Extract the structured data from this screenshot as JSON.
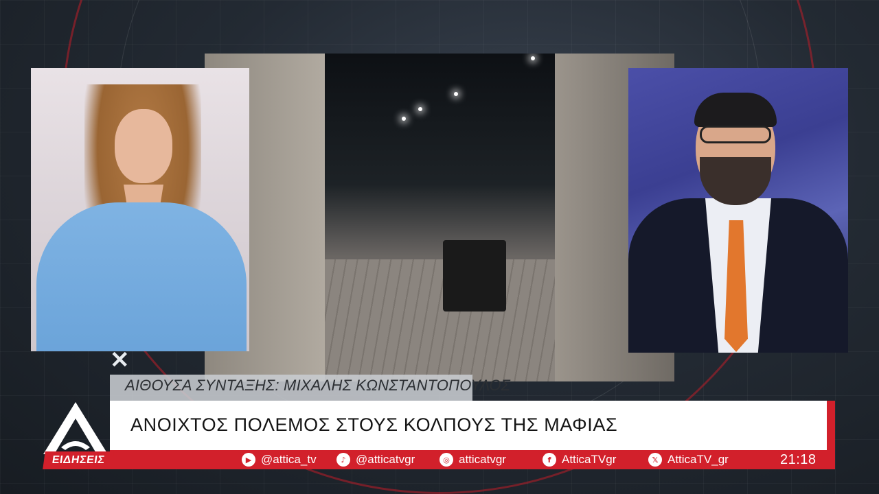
{
  "reporter": {
    "text": "ΑΙΘΟΥΣΑ ΣΥΝΤΑΞΗΣ: ΜΙΧΑΛΗΣ ΚΩΝΣΤΑΝΤΟΠΟΥΛΟΣ"
  },
  "headline": {
    "text": "ΑΝΟΙΧΤΟΣ ΠΟΛΕΜΟΣ ΣΤΟΥΣ ΚΟΛΠΟΥΣ ΤΗΣ ΜΑΦΙΑΣ"
  },
  "logo": {
    "label": "ΕΙΔΗΣΕΙΣ",
    "color": "#d2202b"
  },
  "socials": [
    {
      "icon": "youtube-icon",
      "glyph": "▶",
      "handle": "@attica_tv"
    },
    {
      "icon": "tiktok-icon",
      "glyph": "♪",
      "handle": "@atticatvgr"
    },
    {
      "icon": "instagram-icon",
      "glyph": "◎",
      "handle": "atticatvgr"
    },
    {
      "icon": "facebook-icon",
      "glyph": "f",
      "handle": "AtticaTVgr"
    },
    {
      "icon": "x-icon",
      "glyph": "𝕏",
      "handle": "AtticaTV_gr"
    }
  ],
  "clock": {
    "time": "21:18"
  },
  "colors": {
    "accent": "#d2202b",
    "headline_bg": "#ffffff",
    "reporter_bg": "#c8ccd0"
  }
}
